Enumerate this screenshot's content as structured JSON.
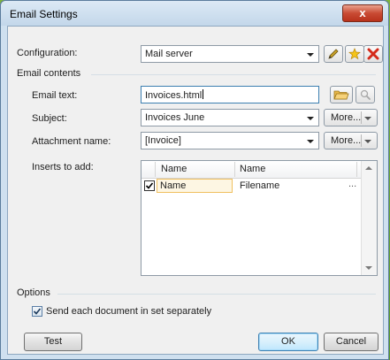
{
  "window": {
    "title": "Email Settings",
    "close_glyph": "x"
  },
  "configuration": {
    "label": "Configuration:",
    "value": "Mail server",
    "icons": [
      "pencil-icon",
      "new-star-icon",
      "delete-x-icon"
    ]
  },
  "email_contents": {
    "section_label": "Email contents",
    "email_text": {
      "label": "Email text:",
      "value": "Invoices.html"
    },
    "subject": {
      "label": "Subject:",
      "value": "Invoices June",
      "more_label": "More..."
    },
    "attachment": {
      "label": "Attachment name:",
      "value": "[Invoice]",
      "more_label": "More..."
    },
    "inserts": {
      "label": "Inserts to add:",
      "columns": [
        "Name",
        "Name"
      ],
      "rows": [
        {
          "checked": true,
          "name": "Name",
          "value": "Filename",
          "ellipsis": "..."
        }
      ]
    }
  },
  "options": {
    "section_label": "Options",
    "send_separately": {
      "label": "Send each document in set separately",
      "checked": true
    }
  },
  "buttons": {
    "test": "Test",
    "ok": "OK",
    "cancel": "Cancel"
  },
  "colors": {
    "accent_blue": "#3c7fb1",
    "close_red": "#c94a33",
    "background_green": "#6aa836"
  }
}
